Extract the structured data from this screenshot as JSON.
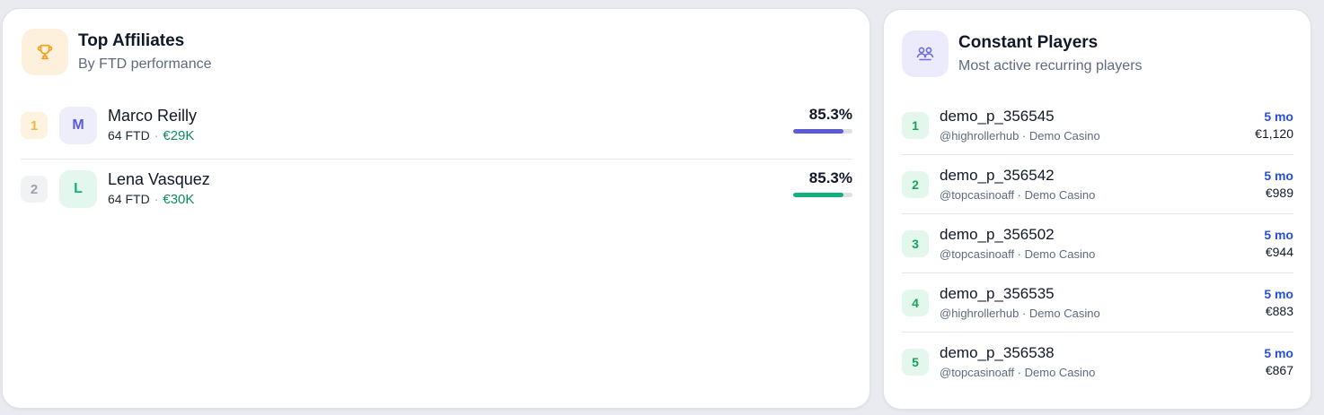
{
  "top_affiliates": {
    "title": "Top Affiliates",
    "subtitle": "By FTD performance",
    "icon": "trophy-icon",
    "rows": [
      {
        "rank": "1",
        "avatar_letter": "M",
        "name": "Marco Reilly",
        "ftd": "64 FTD",
        "separator": "·",
        "amount": "€29K",
        "percent_label": "85.3%",
        "progress": 0.853,
        "bar_color": "#5b5bd6"
      },
      {
        "rank": "2",
        "avatar_letter": "L",
        "name": "Lena Vasquez",
        "ftd": "64 FTD",
        "separator": "·",
        "amount": "€30K",
        "percent_label": "85.3%",
        "progress": 0.853,
        "bar_color": "#12b07a"
      }
    ]
  },
  "constant_players": {
    "title": "Constant Players",
    "subtitle": "Most active recurring players",
    "icon": "people-icon",
    "rows": [
      {
        "rank": "1",
        "name": "demo_p_356545",
        "sub": "@highrollerhub · Demo Casino",
        "tenure": "5 mo",
        "value": "€1,120"
      },
      {
        "rank": "2",
        "name": "demo_p_356542",
        "sub": "@topcasinoaff · Demo Casino",
        "tenure": "5 mo",
        "value": "€989"
      },
      {
        "rank": "3",
        "name": "demo_p_356502",
        "sub": "@topcasinoaff · Demo Casino",
        "tenure": "5 mo",
        "value": "€944"
      },
      {
        "rank": "4",
        "name": "demo_p_356535",
        "sub": "@highrollerhub · Demo Casino",
        "tenure": "5 mo",
        "value": "€883"
      },
      {
        "rank": "5",
        "name": "demo_p_356538",
        "sub": "@topcasinoaff · Demo Casino",
        "tenure": "5 mo",
        "value": "€867"
      }
    ]
  }
}
